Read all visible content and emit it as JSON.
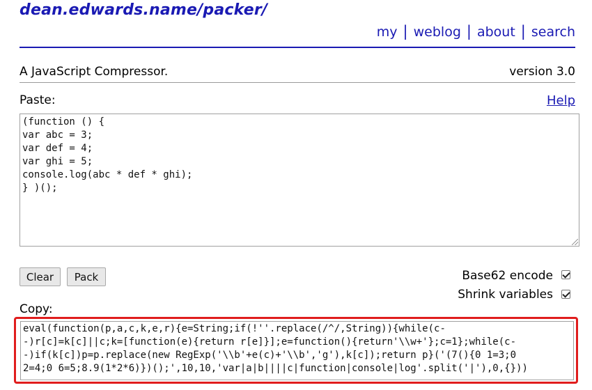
{
  "site": {
    "title": "dean.edwards.name/packer/"
  },
  "nav": {
    "items": [
      "my",
      "weblog",
      "about",
      "search"
    ],
    "separator": "|"
  },
  "header": {
    "tagline": "A JavaScript Compressor.",
    "version": "version 3.0"
  },
  "paste": {
    "label": "Paste:",
    "help_label": "Help",
    "value": "(function () {\nvar abc = 3;\nvar def = 4;\nvar ghi = 5;\nconsole.log(abc * def * ghi);\n} )();"
  },
  "buttons": {
    "clear_label": "Clear",
    "pack_label": "Pack"
  },
  "options": {
    "base62_label": "Base62 encode",
    "base62_checked": true,
    "shrink_label": "Shrink variables",
    "shrink_checked": true
  },
  "copy": {
    "label": "Copy:",
    "value": "eval(function(p,a,c,k,e,r){e=String;if(!''.replace(/^/,String)){while(c-\n-)r[c]=k[c]||c;k=[function(e){return r[e]}];e=function(){return'\\\\w+'};c=1};while(c-\n-)if(k[c])p=p.replace(new RegExp('\\\\b'+e(c)+'\\\\b','g'),k[c]);return p}('(7(){0 1=3;0\n2=4;0 6=5;8.9(1*2*6)})();',10,10,'var|a|b||||c|function|console|log'.split('|'),0,{}))"
  },
  "colors": {
    "link": "#1a1ab3",
    "highlight": "#e01d1d"
  }
}
